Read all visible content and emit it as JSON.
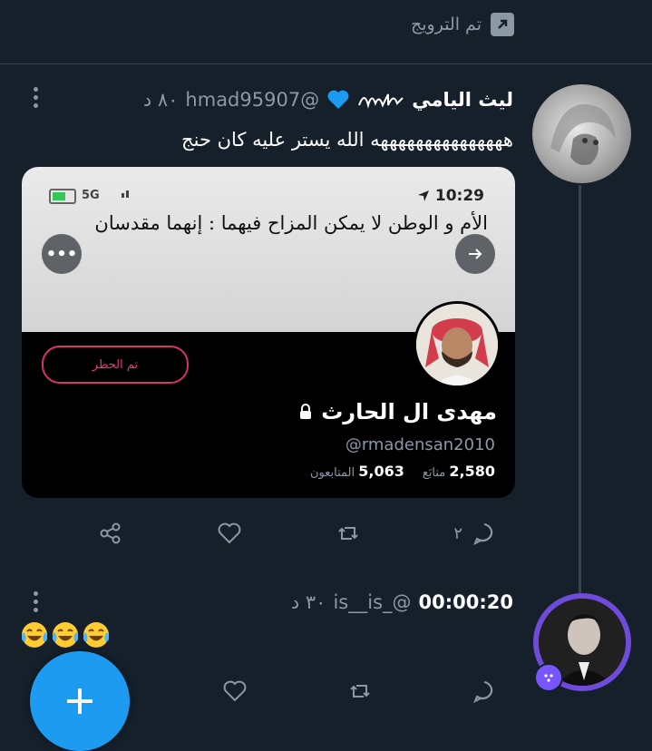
{
  "retweet_bar": {
    "label": "تم الترويج"
  },
  "tweet1": {
    "name": "ليث اليامي",
    "handle": "@hmad95907",
    "time": "٨٠ د",
    "text": "هههههههههههههههه الله يستر عليه كان حنج",
    "card": {
      "status_time": "10:29",
      "network": "5G",
      "quote": "الأم و الوطن لا يمكن المزاح فيهما : إنهما مقدسان",
      "blocked_label": "تم الحظر",
      "profile_name": "مهدى ال الحارث",
      "profile_handle": "@rmadensan2010",
      "following_count": "2,580",
      "following_label": "متابَع",
      "followers_count": "5,063",
      "followers_label": "المتابعون"
    },
    "reply_count": "٢"
  },
  "tweet2": {
    "name": "00:00:20",
    "handle": "@_is__is",
    "time": "٣٠ د",
    "emojis": [
      "face-with-tears-of-joy",
      "face-with-tears-of-joy",
      "face-with-tears-of-joy"
    ]
  },
  "colors": {
    "background": "#15202b",
    "secondary_text": "#8b98a5",
    "accent": "#1d9bf0",
    "heart_emoji": "#1d9bf0",
    "block_red": "#e43d7a"
  },
  "icons": [
    "retweet-arrow-icon",
    "more-vertical-icon",
    "blue-heart-icon",
    "share-icon",
    "like-icon",
    "retweet-icon",
    "reply-icon",
    "compose-icon",
    "spaces-icon"
  ]
}
